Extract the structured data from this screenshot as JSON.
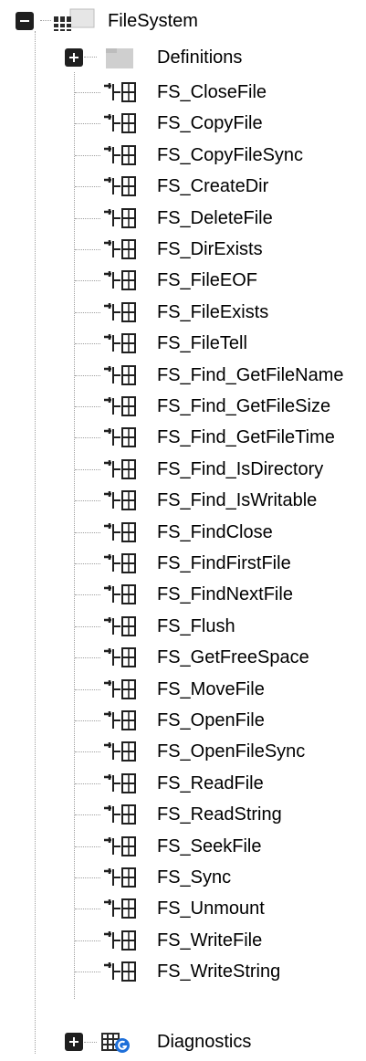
{
  "tree": {
    "root": {
      "label": "FileSystem",
      "icon": "library-icon",
      "expanded": true
    },
    "definitions": {
      "label": "Definitions",
      "icon": "folder-icon",
      "expanded": false
    },
    "functions": [
      "FS_CloseFile",
      "FS_CopyFile",
      "FS_CopyFileSync",
      "FS_CreateDir",
      "FS_DeleteFile",
      "FS_DirExists",
      "FS_FileEOF",
      "FS_FileExists",
      "FS_FileTell",
      "FS_Find_GetFileName",
      "FS_Find_GetFileSize",
      "FS_Find_GetFileTime",
      "FS_Find_IsDirectory",
      "FS_Find_IsWritable",
      "FS_FindClose",
      "FS_FindFirstFile",
      "FS_FindNextFile",
      "FS_Flush",
      "FS_GetFreeSpace",
      "FS_MoveFile",
      "FS_OpenFile",
      "FS_OpenFileSync",
      "FS_ReadFile",
      "FS_ReadString",
      "FS_SeekFile",
      "FS_Sync",
      "FS_Unmount",
      "FS_WriteFile",
      "FS_WriteString"
    ],
    "function_icon": "function-block-icon",
    "diagnostics": {
      "label": "Diagnostics",
      "icon": "diagnostics-icon",
      "expanded": false
    }
  },
  "colors": {
    "tree_line": "#a0a0a0",
    "icon_dark": "#1f1f1f",
    "folder": "#c8c8c8",
    "diag_blue": "#1e6fd9"
  }
}
